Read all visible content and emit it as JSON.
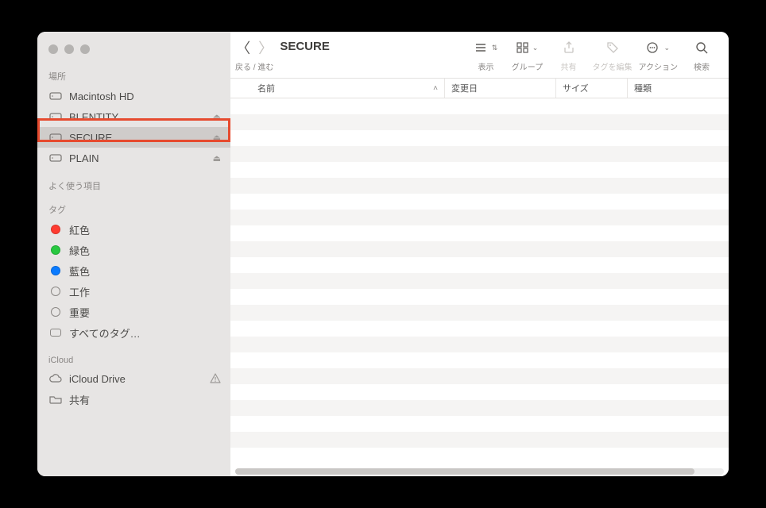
{
  "title": "SECURE",
  "toolbar": {
    "nav_label": "戻る / 進む",
    "view_label": "表示",
    "group_label": "グループ",
    "share_label": "共有",
    "tags_label": "タグを編集",
    "action_label": "アクション",
    "search_label": "検索"
  },
  "columns": {
    "name": "名前",
    "date": "変更日",
    "size": "サイズ",
    "kind": "種類"
  },
  "sidebar": {
    "locations_header": "場所",
    "locations": [
      {
        "label": "Macintosh HD",
        "ejectable": false
      },
      {
        "label": "BLENTITY",
        "ejectable": true
      },
      {
        "label": "SECURE",
        "ejectable": true,
        "selected": true
      },
      {
        "label": "PLAIN",
        "ejectable": true
      }
    ],
    "favorites_header": "よく使う項目",
    "tags_header": "タグ",
    "tags": [
      {
        "label": "紅色",
        "color": "#ff3b30"
      },
      {
        "label": "緑色",
        "color": "#28c840"
      },
      {
        "label": "藍色",
        "color": "#0a7bff"
      },
      {
        "label": "工作",
        "color": null
      },
      {
        "label": "重要",
        "color": null
      }
    ],
    "all_tags_label": "すべてのタグ…",
    "icloud_header": "iCloud",
    "icloud_drive_label": "iCloud Drive",
    "shared_label": "共有"
  }
}
